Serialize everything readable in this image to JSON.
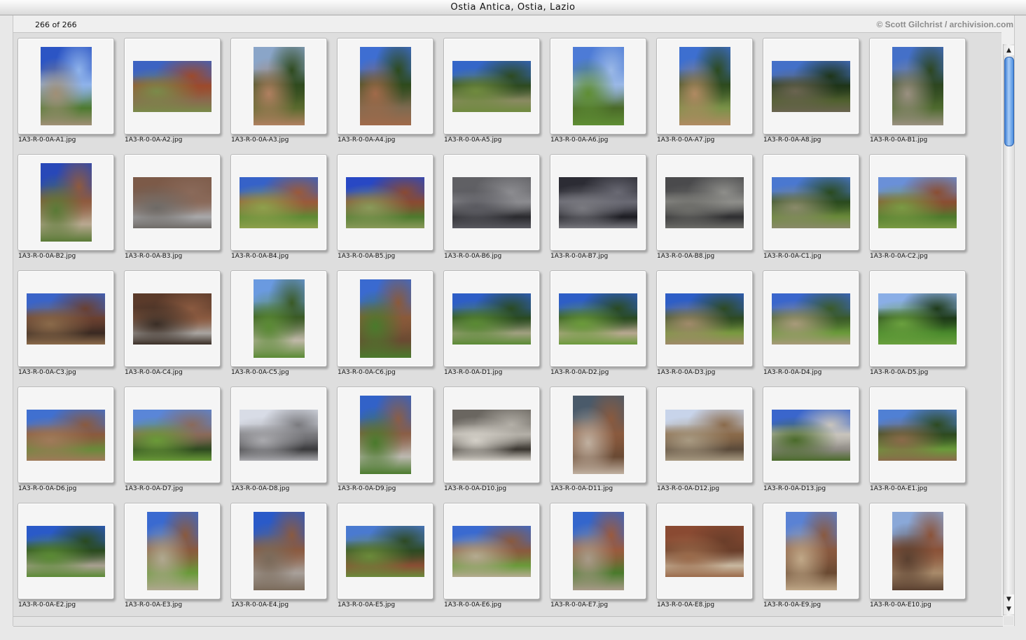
{
  "window": {
    "title": "Ostia Antica, Ostia, Lazio"
  },
  "header": {
    "count": "266 of 266",
    "credit": "© Scott Gilchrist / archivision.com"
  },
  "thumbnails": [
    {
      "file": "1A3-R-0-0A-A1.jpg",
      "orientation": "portrait",
      "colors": [
        "#2c55c4",
        "#8fb3ea",
        "#4d7a2f",
        "#a08f76"
      ]
    },
    {
      "file": "1A3-R-0-0A-A2.jpg",
      "orientation": "landscape",
      "colors": [
        "#3d63c2",
        "#9c4a2c",
        "#8a6a4e",
        "#7a8a4a"
      ]
    },
    {
      "file": "1A3-R-0-0A-A3.jpg",
      "orientation": "portrait",
      "colors": [
        "#8aa5c8",
        "#2f4a1e",
        "#5a6a2e",
        "#b08060"
      ]
    },
    {
      "file": "1A3-R-0-0A-A4.jpg",
      "orientation": "portrait",
      "colors": [
        "#3e6ed2",
        "#2e4a1c",
        "#7e6a50",
        "#a06a4a"
      ]
    },
    {
      "file": "1A3-R-0-0A-A5.jpg",
      "orientation": "landscape",
      "colors": [
        "#3466c8",
        "#2d4a20",
        "#8a8a62",
        "#6f8a3e"
      ]
    },
    {
      "file": "1A3-R-0-0A-A6.jpg",
      "orientation": "portrait",
      "colors": [
        "#4d7bd6",
        "#9ab8e6",
        "#4a6a28",
        "#5f8e34"
      ]
    },
    {
      "file": "1A3-R-0-0A-A7.jpg",
      "orientation": "portrait",
      "colors": [
        "#3d6fd0",
        "#2d4a1e",
        "#7a9248",
        "#b08a62"
      ]
    },
    {
      "file": "1A3-R-0-0A-A8.jpg",
      "orientation": "landscape",
      "colors": [
        "#4470c8",
        "#1e3418",
        "#50602e",
        "#6a6450"
      ]
    },
    {
      "file": "1A3-R-0-0A-B1.jpg",
      "orientation": "portrait",
      "colors": [
        "#4470c8",
        "#2d4620",
        "#4e6a2e",
        "#9a9080"
      ]
    },
    {
      "file": "1A3-R-0-0A-B2.jpg",
      "orientation": "portrait",
      "colors": [
        "#2848b8",
        "#8e5a3e",
        "#b8a890",
        "#5a7a36"
      ]
    },
    {
      "file": "1A3-R-0-0A-B3.jpg",
      "orientation": "landscape",
      "colors": [
        "#7c5a48",
        "#8a6a5a",
        "#a8a8aa",
        "#6e6a66"
      ]
    },
    {
      "file": "1A3-R-0-0A-B4.jpg",
      "orientation": "landscape",
      "colors": [
        "#3662c8",
        "#9a5a3a",
        "#5e8a34",
        "#8ea04c"
      ]
    },
    {
      "file": "1A3-R-0-0A-B5.jpg",
      "orientation": "landscape",
      "colors": [
        "#2848c4",
        "#8a4a32",
        "#4e7a2e",
        "#8a9a5a"
      ]
    },
    {
      "file": "1A3-R-0-0A-B6.jpg",
      "orientation": "landscape",
      "colors": [
        "#606064",
        "#8c8c90",
        "#2a2a2e",
        "#5a5a60"
      ]
    },
    {
      "file": "1A3-R-0-0A-B7.jpg",
      "orientation": "landscape",
      "colors": [
        "#2c2c34",
        "#6a6a74",
        "#1c1c22",
        "#7a7a80"
      ]
    },
    {
      "file": "1A3-R-0-0A-B8.jpg",
      "orientation": "landscape",
      "colors": [
        "#4a4a4c",
        "#8e8e8a",
        "#2e2e30",
        "#6e6e6a"
      ]
    },
    {
      "file": "1A3-R-0-0A-C1.jpg",
      "orientation": "landscape",
      "colors": [
        "#4a78d0",
        "#2a4a1e",
        "#6a8a3a",
        "#8a8a6a"
      ]
    },
    {
      "file": "1A3-R-0-0A-C2.jpg",
      "orientation": "landscape",
      "colors": [
        "#6a90d8",
        "#8a4e32",
        "#4e7a2c",
        "#7a9a44"
      ]
    },
    {
      "file": "1A3-R-0-0A-C3.jpg",
      "orientation": "landscape",
      "colors": [
        "#3a64c8",
        "#6a4030",
        "#3a2a22",
        "#8a6a4a"
      ]
    },
    {
      "file": "1A3-R-0-0A-C4.jpg",
      "orientation": "landscape",
      "colors": [
        "#5a3a2a",
        "#8a5a40",
        "#a8a4a0",
        "#3a2e26"
      ]
    },
    {
      "file": "1A3-R-0-0A-C5.jpg",
      "orientation": "portrait",
      "colors": [
        "#6a9ae0",
        "#3a5a24",
        "#c0b8a8",
        "#5a8a34"
      ]
    },
    {
      "file": "1A3-R-0-0A-C6.jpg",
      "orientation": "portrait",
      "colors": [
        "#3a6ad0",
        "#8a5a3a",
        "#6a4a32",
        "#4a7a2c"
      ]
    },
    {
      "file": "1A3-R-0-0A-D1.jpg",
      "orientation": "landscape",
      "colors": [
        "#2e5ec6",
        "#2a4a20",
        "#a0a080",
        "#5a8a34"
      ]
    },
    {
      "file": "1A3-R-0-0A-D2.jpg",
      "orientation": "landscape",
      "colors": [
        "#2e5ec6",
        "#2a4a20",
        "#b8a890",
        "#6a9a3a"
      ]
    },
    {
      "file": "1A3-R-0-0A-D3.jpg",
      "orientation": "landscape",
      "colors": [
        "#2e5ec6",
        "#2e4a22",
        "#7a9a40",
        "#a08a6a"
      ]
    },
    {
      "file": "1A3-R-0-0A-D4.jpg",
      "orientation": "landscape",
      "colors": [
        "#3a66cc",
        "#3a5a28",
        "#6a9a3a",
        "#a89a7a"
      ]
    },
    {
      "file": "1A3-R-0-0A-D5.jpg",
      "orientation": "landscape",
      "colors": [
        "#8aaee6",
        "#1e3a18",
        "#4a8a2c",
        "#6aa03e"
      ]
    },
    {
      "file": "1A3-R-0-0A-D6.jpg",
      "orientation": "landscape",
      "colors": [
        "#4070d0",
        "#8a5a3e",
        "#6a8a3a",
        "#a07a5a"
      ]
    },
    {
      "file": "1A3-R-0-0A-D7.jpg",
      "orientation": "landscape",
      "colors": [
        "#5a86d8",
        "#8a6a5a",
        "#2e4a20",
        "#6a9a38"
      ]
    },
    {
      "file": "1A3-R-0-0A-D8.jpg",
      "orientation": "landscape",
      "colors": [
        "#d8dce6",
        "#7a7a7e",
        "#3a3a3c",
        "#aaaaae"
      ]
    },
    {
      "file": "1A3-R-0-0A-D9.jpg",
      "orientation": "portrait",
      "colors": [
        "#3262c8",
        "#8a5e46",
        "#bcb8b0",
        "#4a7a2c"
      ]
    },
    {
      "file": "1A3-R-0-0A-D10.jpg",
      "orientation": "landscape",
      "colors": [
        "#6a6660",
        "#b4b0a8",
        "#3a3630",
        "#d4d0c8"
      ]
    },
    {
      "file": "1A3-R-0-0A-D11.jpg",
      "orientation": "portrait",
      "colors": [
        "#4a5a6a",
        "#8a5a3e",
        "#6a4a34",
        "#c0b0a0"
      ]
    },
    {
      "file": "1A3-R-0-0A-D12.jpg",
      "orientation": "landscape",
      "colors": [
        "#c8d4ea",
        "#8a6a4a",
        "#5a4a3a",
        "#a89a82"
      ]
    },
    {
      "file": "1A3-R-0-0A-D13.jpg",
      "orientation": "landscape",
      "colors": [
        "#3a66cc",
        "#c8c4bc",
        "#8e8a84",
        "#4a6a2a"
      ]
    },
    {
      "file": "1A3-R-0-0A-E1.jpg",
      "orientation": "landscape",
      "colors": [
        "#5080d4",
        "#2e4a20",
        "#6a9a3a",
        "#8a6a4a"
      ]
    },
    {
      "file": "1A3-R-0-0A-E2.jpg",
      "orientation": "landscape",
      "colors": [
        "#2a5ac8",
        "#2a4a1e",
        "#a8a090",
        "#5a8a34"
      ]
    },
    {
      "file": "1A3-R-0-0A-E3.jpg",
      "orientation": "portrait",
      "colors": [
        "#3a6ad0",
        "#8a5a3e",
        "#6a9a3a",
        "#b0a890"
      ]
    },
    {
      "file": "1A3-R-0-0A-E4.jpg",
      "orientation": "portrait",
      "colors": [
        "#2a5ac8",
        "#8a5a40",
        "#a8a09a",
        "#7a6a5a"
      ]
    },
    {
      "file": "1A3-R-0-0A-E5.jpg",
      "orientation": "landscape",
      "colors": [
        "#4a7ad0",
        "#2e4a22",
        "#8a4e34",
        "#6a8a3a"
      ]
    },
    {
      "file": "1A3-R-0-0A-E6.jpg",
      "orientation": "landscape",
      "colors": [
        "#3a6ad0",
        "#8a5a3e",
        "#6a9a3a",
        "#b4aa90"
      ]
    },
    {
      "file": "1A3-R-0-0A-E7.jpg",
      "orientation": "portrait",
      "colors": [
        "#3466cc",
        "#9a5a3e",
        "#4a7a2c",
        "#a89a88"
      ]
    },
    {
      "file": "1A3-R-0-0A-E8.jpg",
      "orientation": "landscape",
      "colors": [
        "#8a4a32",
        "#6a3e2a",
        "#c8b8a0",
        "#9a6a4a"
      ]
    },
    {
      "file": "1A3-R-0-0A-E9.jpg",
      "orientation": "portrait",
      "colors": [
        "#5a82d4",
        "#8a5a40",
        "#6a4a32",
        "#c0a888"
      ]
    },
    {
      "file": "1A3-R-0-0A-E10.jpg",
      "orientation": "portrait",
      "colors": [
        "#8aa8d8",
        "#8a5238",
        "#a88a6a",
        "#5a4030"
      ]
    }
  ]
}
